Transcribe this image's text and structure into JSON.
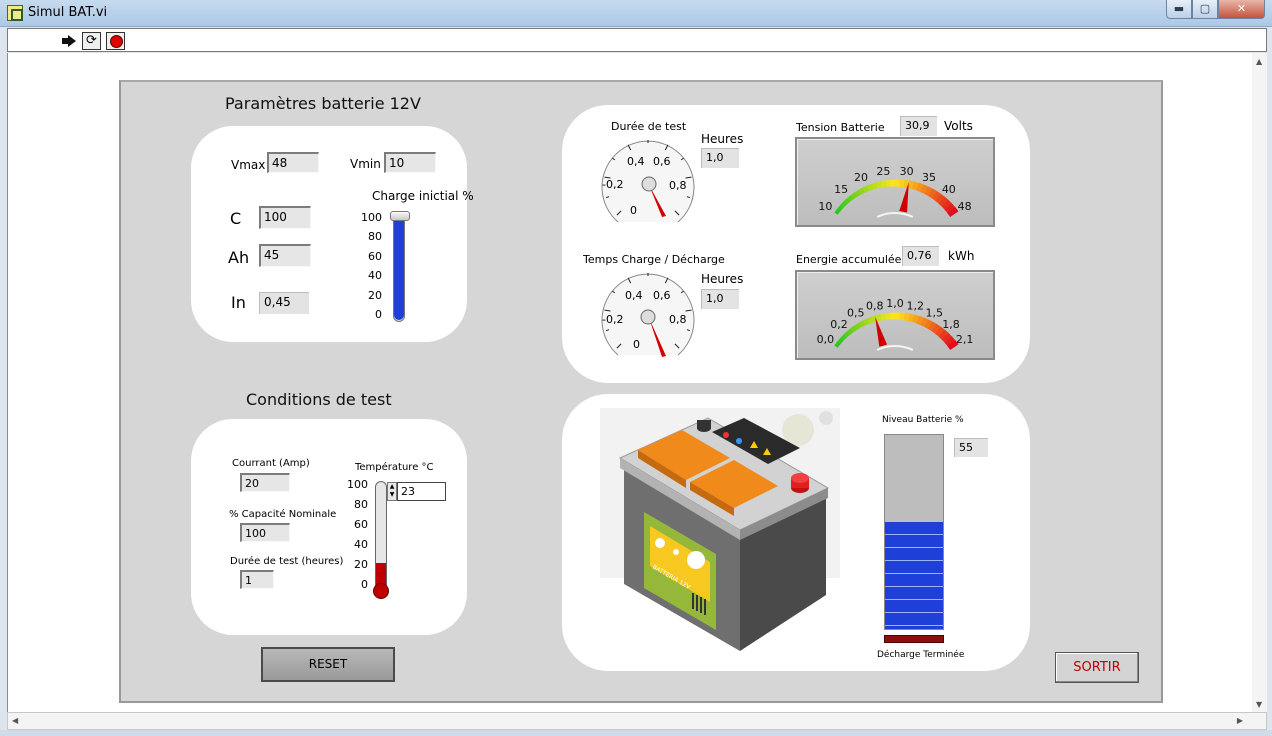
{
  "window": {
    "title": "Simul BAT.vi",
    "min": "▬",
    "max": "▢",
    "close": "✕"
  },
  "toolbar": {
    "run_icon": "run-arrow-icon",
    "continuous_icon": "run-continuously-icon",
    "continuous_glyph": "⟳",
    "abort_icon": "abort-stop-icon"
  },
  "params": {
    "title": "Paramètres batterie 12V",
    "vmax_label": "Vmax",
    "vmax_value": "48",
    "vmin_label": "Vmin",
    "vmin_value": "10",
    "c_label": "C",
    "c_value": "100",
    "ah_label": "Ah",
    "ah_value": "45",
    "in_label": "In",
    "in_value": "0,45",
    "charge_label": "Charge inictial %",
    "charge_ticks": [
      "100",
      "80",
      "60",
      "40",
      "20",
      "0"
    ],
    "charge_level": 100
  },
  "conditions": {
    "title": "Conditions de test",
    "courant_label": "Courrant (Amp)",
    "courant_value": "20",
    "capacite_label": "% Capacité Nominale",
    "capacite_value": "100",
    "duree_label": "Durée de test (heures)",
    "duree_value": "1",
    "temp_label": "Température °C",
    "temp_ticks": [
      "100",
      "80",
      "60",
      "40",
      "20",
      "0"
    ],
    "temp_value": "23",
    "temp_level": 23
  },
  "gauges": {
    "duree": {
      "title": "Durée de test",
      "unit_label": "Heures",
      "value": "1,0",
      "ticks": [
        "0",
        "-0,2",
        "0,4",
        "0,6",
        "0,8"
      ]
    },
    "temps": {
      "title": "Temps Charge / Décharge",
      "unit_label": "Heures",
      "value": "1,0",
      "ticks": [
        "0",
        "-0,2",
        "0,4",
        "0,6",
        "0,8"
      ]
    },
    "tension": {
      "title": "Tension Batterie",
      "value": "30,9",
      "unit": "Volts",
      "ticks": [
        "10",
        "15",
        "20",
        "25",
        "30",
        "35",
        "40",
        "48"
      ],
      "needle_value": 30.9
    },
    "energie": {
      "title": "Energie accumulée",
      "value": "0,76",
      "unit": "kWh",
      "ticks": [
        "0,0",
        "0,2",
        "0,5",
        "0,8",
        "1,0",
        "1,2",
        "1,5",
        "1,8",
        "2,1"
      ],
      "needle_value": 0.76
    }
  },
  "battery": {
    "niveau_label": "Niveau Batterie %",
    "niveau_value": "55",
    "niveau_level": 55,
    "status_label": "Décharge Terminée",
    "image_icon": "car-battery-illustration",
    "brand_text": "BATTERIA 12V"
  },
  "buttons": {
    "reset": "RESET",
    "sortir": "SORTIR"
  },
  "colors": {
    "accent_blue": "#1e3fd8",
    "alarm_red": "#c00000",
    "battery_orange": "#f08a1a"
  }
}
